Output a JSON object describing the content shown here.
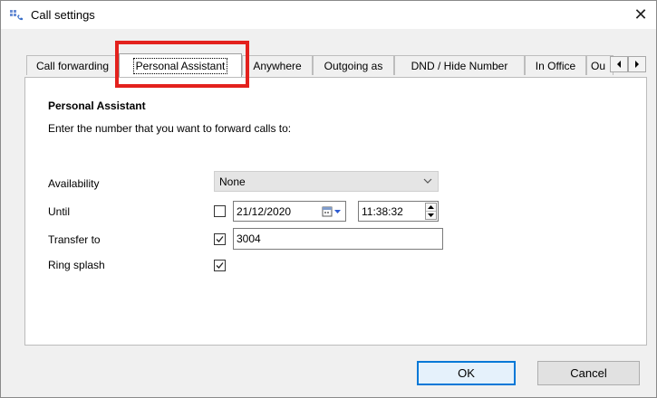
{
  "window": {
    "title": "Call settings",
    "close_glyph": "✕",
    "app_icon": "call-settings-icon"
  },
  "tabs": [
    {
      "label": "Call forwarding",
      "active": false
    },
    {
      "label": "Personal Assistant",
      "active": true
    },
    {
      "label": "Anywhere",
      "active": false
    },
    {
      "label": "Outgoing as",
      "active": false
    },
    {
      "label": "DND / Hide Number",
      "active": false
    },
    {
      "label": "In Office",
      "active": false
    },
    {
      "label": "Ou",
      "active": false
    }
  ],
  "tab_scroll": {
    "left_icon": "scroll-left-icon",
    "right_icon": "scroll-right-icon"
  },
  "highlight_color": "#e3211d",
  "panel": {
    "section_title": "Personal Assistant",
    "instruction": "Enter the number that you want to forward calls to:",
    "availability": {
      "label": "Availability",
      "selected": "None"
    },
    "until": {
      "label": "Until",
      "checked": false,
      "date": "21/12/2020",
      "time": "11:38:32"
    },
    "transfer_to": {
      "label": "Transfer to",
      "checked": true,
      "value": "3004"
    },
    "ring_splash": {
      "label": "Ring splash",
      "checked": true
    }
  },
  "buttons": {
    "ok": "OK",
    "cancel": "Cancel"
  },
  "colors": {
    "ok_border": "#0078d7",
    "ok_fill": "#e5f1fb"
  }
}
